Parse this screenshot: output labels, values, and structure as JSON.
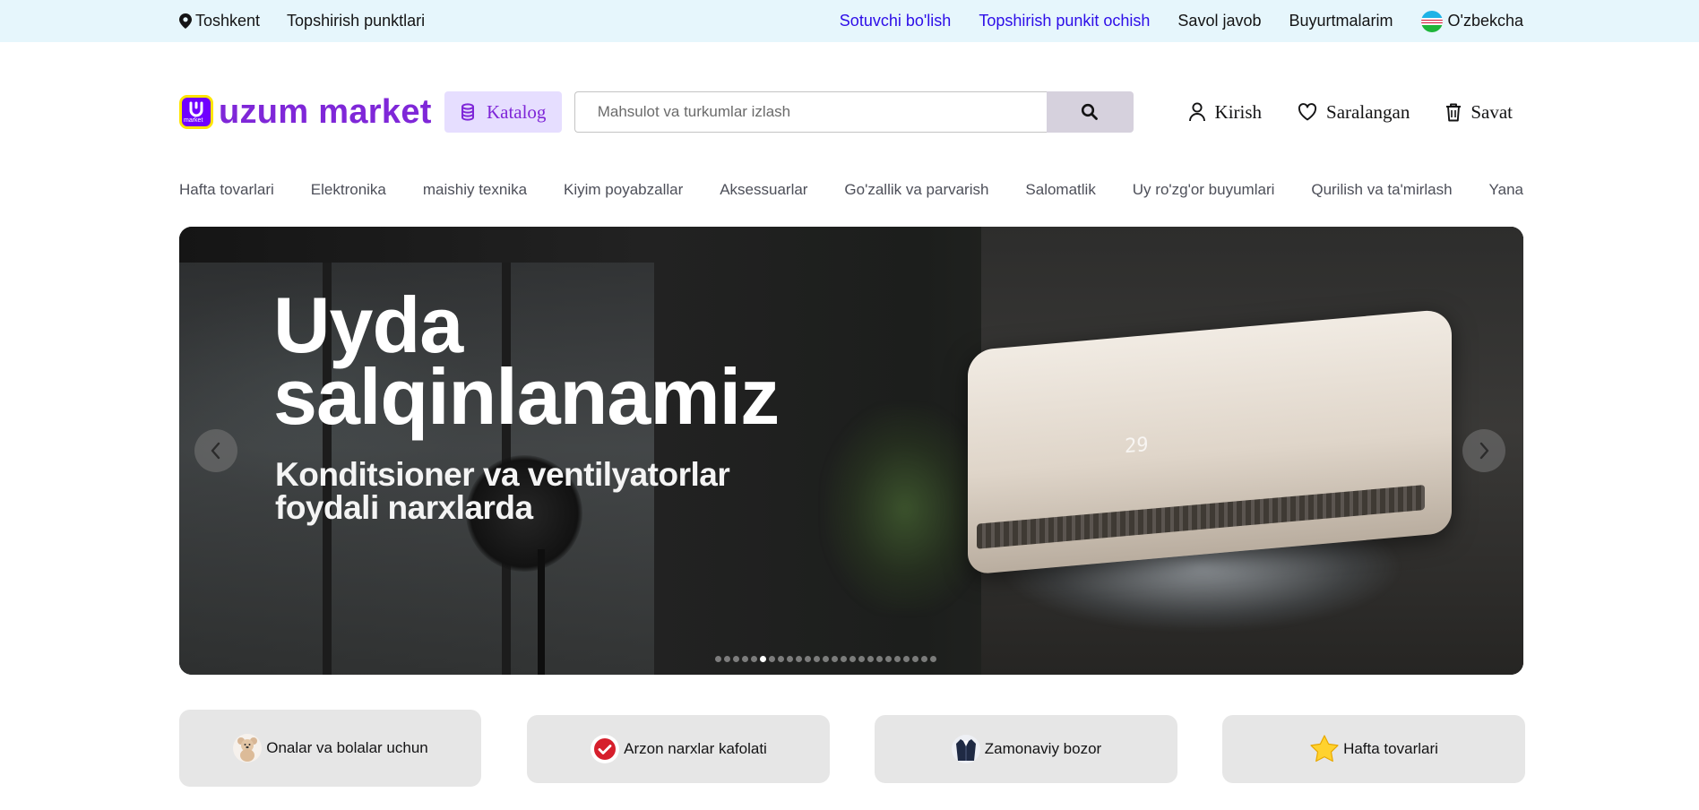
{
  "topbar": {
    "city": "Toshkent",
    "pickup_points": "Topshirish punktlari",
    "links": [
      {
        "label": "Sotuvchi bo'lish",
        "accent": true
      },
      {
        "label": "Topshirish punkit ochish",
        "accent": true
      },
      {
        "label": "Savol javob",
        "accent": false
      },
      {
        "label": "Buyurtmalarim",
        "accent": false
      }
    ],
    "language": "O'zbekcha",
    "accent_color": "#2d0de8"
  },
  "header": {
    "logo_text": "uzum market",
    "logo_badge": "market",
    "catalog_label": "Katalog",
    "search_placeholder": "Mahsulot va turkumlar izlash",
    "search_value": "",
    "login_label": "Kirish",
    "favorites_label": "Saralangan",
    "cart_label": "Savat",
    "brand_color": "#7f27d8"
  },
  "categories": [
    "Hafta tovarlari",
    "Elektronika",
    "maishiy texnika",
    "Kiyim poyabzallar",
    "Aksessuarlar",
    "Go'zallik va parvarish",
    "Salomatlik",
    "Uy ro'zg'or buyumlari",
    "Qurilish va ta'mirlash",
    "Yana"
  ],
  "banner": {
    "title_line1": "Uyda",
    "title_line2": "salqinlanamiz",
    "subtitle_line1": "Konditsioner va ventilyatorlar",
    "subtitle_line2": "foydali narxlarda",
    "ac_display": "29",
    "slide_count": 25,
    "active_slide": 5
  },
  "quick_links": [
    {
      "label": "Onalar va bolalar uchun",
      "icon": "teddy-bear-icon"
    },
    {
      "label": "Arzon narxlar kafolati",
      "icon": "check-badge-icon"
    },
    {
      "label": "Zamonaviy bozor",
      "icon": "jacket-icon"
    },
    {
      "label": "Hafta tovarlari",
      "icon": "star-icon"
    }
  ]
}
